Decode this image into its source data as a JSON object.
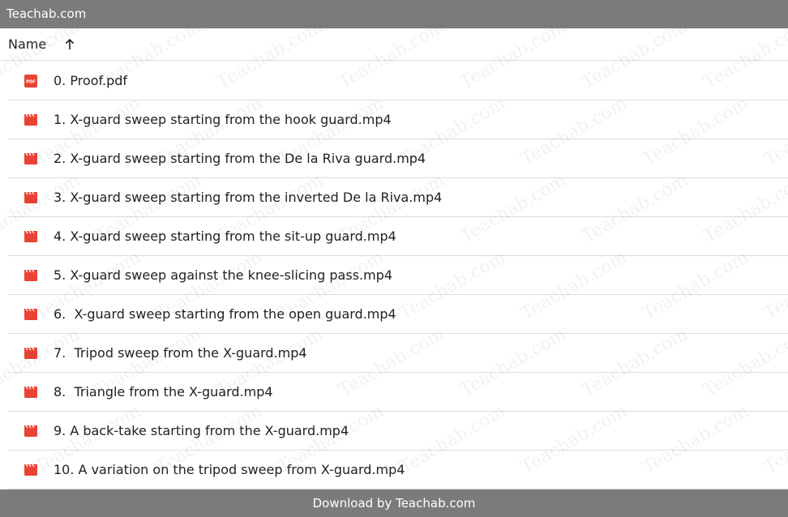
{
  "top_bar": {
    "title": "Teachab.com"
  },
  "header": {
    "name_label": "Name",
    "sort_icon": "arrow-up-icon"
  },
  "files": [
    {
      "name": "0. Proof.pdf",
      "icon": "pdf-icon"
    },
    {
      "name": "1. X-guard sweep starting from the hook guard.mp4",
      "icon": "video-icon"
    },
    {
      "name": "2. X-guard sweep starting from the De la Riva guard.mp4",
      "icon": "video-icon"
    },
    {
      "name": "3. X-guard sweep starting from the inverted De la Riva.mp4",
      "icon": "video-icon"
    },
    {
      "name": "4. X-guard sweep starting from the sit-up guard.mp4",
      "icon": "video-icon"
    },
    {
      "name": "5. X-guard sweep against the knee-slicing pass.mp4",
      "icon": "video-icon"
    },
    {
      "name": "6.  X-guard sweep starting from the open guard.mp4",
      "icon": "video-icon"
    },
    {
      "name": "7.  Tripod sweep from the X-guard.mp4",
      "icon": "video-icon"
    },
    {
      "name": "8.  Triangle from the X-guard.mp4",
      "icon": "video-icon"
    },
    {
      "name": "9. A back-take starting from the X-guard.mp4",
      "icon": "video-icon"
    },
    {
      "name": "10. A variation on the tripod sweep from X-guard.mp4",
      "icon": "video-icon"
    }
  ],
  "footer": {
    "text": "Download by Teachab.com"
  },
  "watermark": {
    "text": "Teachab.com"
  },
  "colors": {
    "bar": "#7b7b7b",
    "icon_red": "#ea4335",
    "divider": "#dadce0"
  }
}
